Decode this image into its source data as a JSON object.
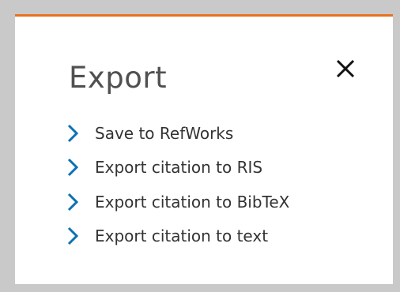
{
  "dialog": {
    "title": "Export",
    "close_icon": "close-icon",
    "accent_color": "#e9711c",
    "chevron_color": "#0b71b3",
    "items": [
      {
        "label": "Save to RefWorks",
        "icon": "chevron-right-icon"
      },
      {
        "label": "Export citation to RIS",
        "icon": "chevron-right-icon"
      },
      {
        "label": "Export citation to BibTeX",
        "icon": "chevron-right-icon"
      },
      {
        "label": "Export citation to text",
        "icon": "chevron-right-icon"
      }
    ]
  }
}
